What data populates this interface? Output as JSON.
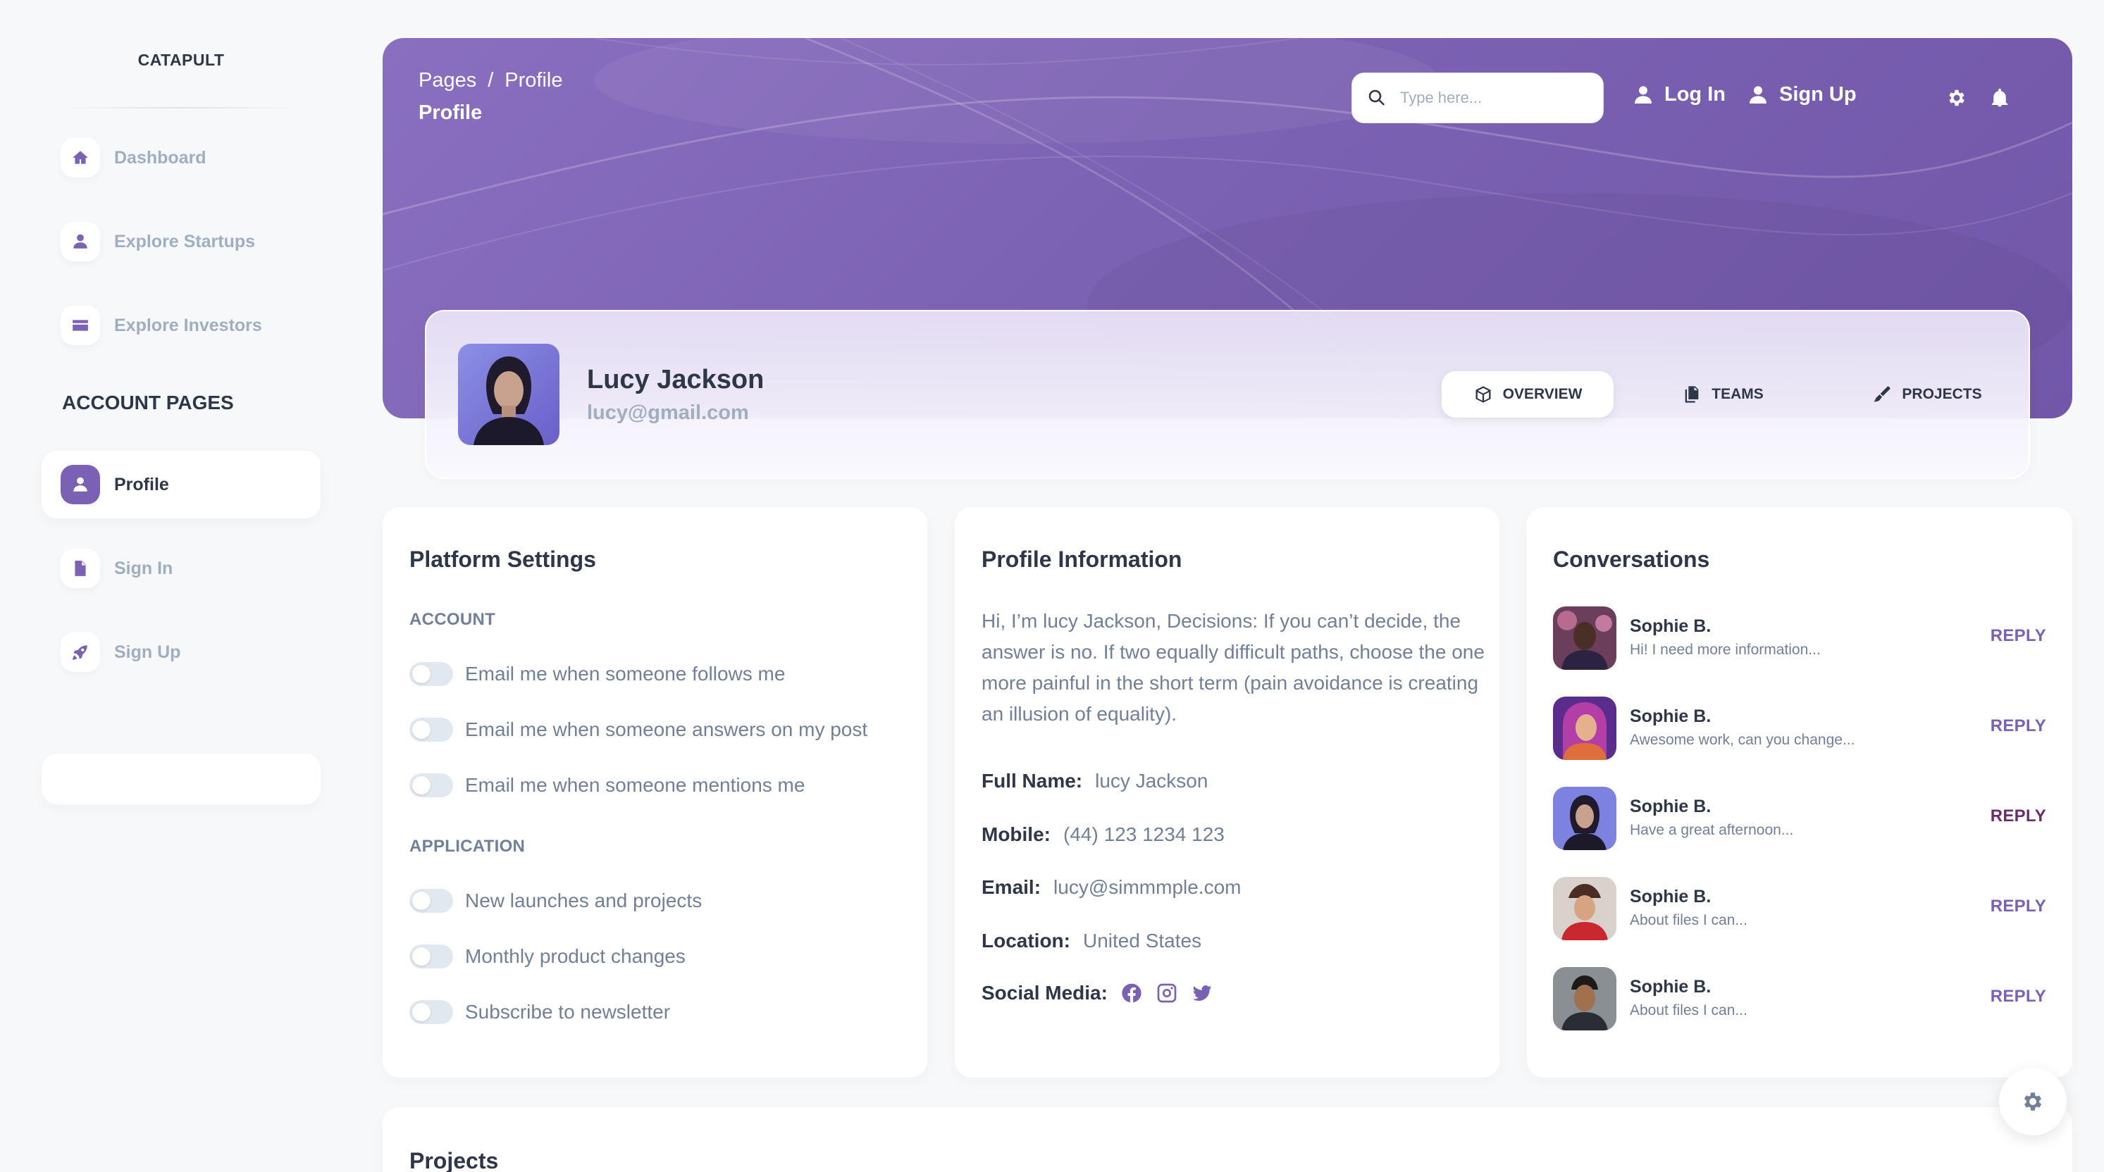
{
  "sidebar": {
    "brand": "CATAPULT",
    "items": [
      {
        "label": "Dashboard",
        "icon": "home-icon"
      },
      {
        "label": "Explore Startups",
        "icon": "person-icon"
      },
      {
        "label": "Explore Investors",
        "icon": "credit-card-icon"
      }
    ],
    "section_title": "ACCOUNT PAGES",
    "account_items": [
      {
        "label": "Profile",
        "icon": "person-icon",
        "active": true
      },
      {
        "label": "Sign In",
        "icon": "document-icon"
      },
      {
        "label": "Sign Up",
        "icon": "rocket-icon"
      }
    ]
  },
  "header": {
    "breadcrumb": [
      "Pages",
      "/",
      "Profile"
    ],
    "title": "Profile",
    "search_placeholder": "Type here...",
    "login_label": "Log In",
    "signup_label": "Sign Up"
  },
  "profile": {
    "name": "Lucy Jackson",
    "email": "lucy@gmail.com",
    "tabs": [
      {
        "label": "OVERVIEW",
        "icon": "cube-icon",
        "active": true
      },
      {
        "label": "TEAMS",
        "icon": "documents-icon"
      },
      {
        "label": "PROJECTS",
        "icon": "brush-icon"
      }
    ]
  },
  "platform_settings": {
    "title": "Platform Settings",
    "account_title": "ACCOUNT",
    "account_toggles": [
      "Email me when someone follows me",
      "Email me when someone answers on my post",
      "Email me when someone mentions me"
    ],
    "application_title": "APPLICATION",
    "application_toggles": [
      "New launches and projects",
      "Monthly product changes",
      "Subscribe to newsletter"
    ]
  },
  "profile_info": {
    "title": "Profile Information",
    "bio": "Hi, I’m lucy Jackson, Decisions: If you can’t decide, the answer is no. If two equally difficult paths, choose the one more painful in the short term (pain avoidance is creating an illusion of equality).",
    "fields": [
      {
        "key": "Full Name:",
        "value": "lucy Jackson"
      },
      {
        "key": "Mobile:",
        "value": "(44) 123 1234 123"
      },
      {
        "key": "Email:",
        "value": "lucy@simmmple.com"
      },
      {
        "key": "Location:",
        "value": "United States"
      }
    ],
    "social_label": "Social Media:",
    "social_icons": [
      "facebook-icon",
      "instagram-icon",
      "twitter-icon"
    ]
  },
  "conversations": {
    "title": "Conversations",
    "reply_label": "REPLY",
    "items": [
      {
        "name": "Sophie B.",
        "message": "Hi! I need more information..."
      },
      {
        "name": "Sophie B.",
        "message": "Awesome work, can you change..."
      },
      {
        "name": "Sophie B.",
        "message": "Have a great afternoon..."
      },
      {
        "name": "Sophie B.",
        "message": "About files I can..."
      },
      {
        "name": "Sophie B.",
        "message": "About files I can..."
      }
    ]
  },
  "projects": {
    "title": "Projects"
  },
  "colors": {
    "accent": "#7b61b4",
    "banner": "#7c62b3",
    "text": "#2d3748",
    "muted": "#718096"
  }
}
